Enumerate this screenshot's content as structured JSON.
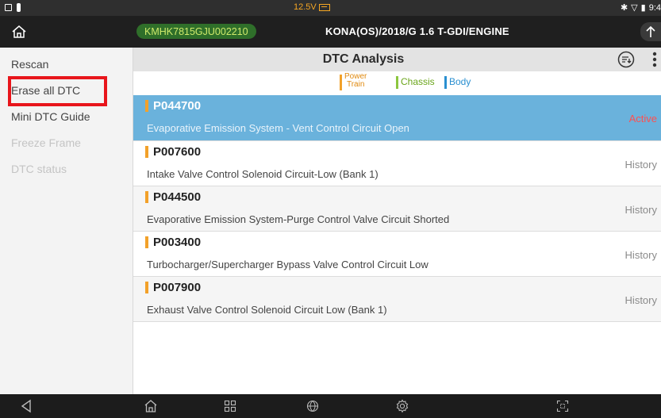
{
  "status_bar": {
    "voltage": "12.5V",
    "time": "9:4",
    "colors": {
      "voltage": "#f5a623"
    }
  },
  "header": {
    "vin": "KMHK7815GJU002210",
    "vehicle": "KONA(OS)/2018/G 1.6 T-GDI/ENGINE"
  },
  "sidebar": {
    "items": [
      {
        "label": "Rescan",
        "enabled": true
      },
      {
        "label": "Erase all DTC",
        "enabled": true
      },
      {
        "label": "Mini DTC Guide",
        "enabled": true
      },
      {
        "label": "Freeze Frame",
        "enabled": false
      },
      {
        "label": "DTC status",
        "enabled": false
      }
    ]
  },
  "main": {
    "title": "DTC Analysis",
    "legend": {
      "power_train_line1": "Power",
      "power_train_line2": "Train",
      "chassis": "Chassis",
      "body": "Body",
      "colors": {
        "power_train": "#f2a12a",
        "chassis": "#8cc63f",
        "body": "#2a8fd0"
      }
    },
    "dtcs": [
      {
        "code": "P044700",
        "description": "Evaporative Emission System - Vent Control Circuit Open",
        "status": "Active"
      },
      {
        "code": "P007600",
        "description": "Intake Valve Control Solenoid Circuit-Low (Bank 1)",
        "status": "History"
      },
      {
        "code": "P044500",
        "description": "Evaporative Emission System-Purge Control Valve Circuit Shorted",
        "status": "History"
      },
      {
        "code": "P003400",
        "description": "Turbocharger/Supercharger Bypass Valve Control Circuit Low",
        "status": "History"
      },
      {
        "code": "P007900",
        "description": "Exhaust Valve Control Solenoid Circuit Low (Bank 1)",
        "status": "History"
      }
    ]
  },
  "icons": {
    "header": [
      "home-icon",
      "upload-icon"
    ],
    "toolbar": [
      "sort-icon",
      "more-vert-icon"
    ],
    "nav": [
      "back-icon",
      "home-icon",
      "apps-icon",
      "globe-icon",
      "settings-icon",
      "screenshot-icon"
    ]
  }
}
